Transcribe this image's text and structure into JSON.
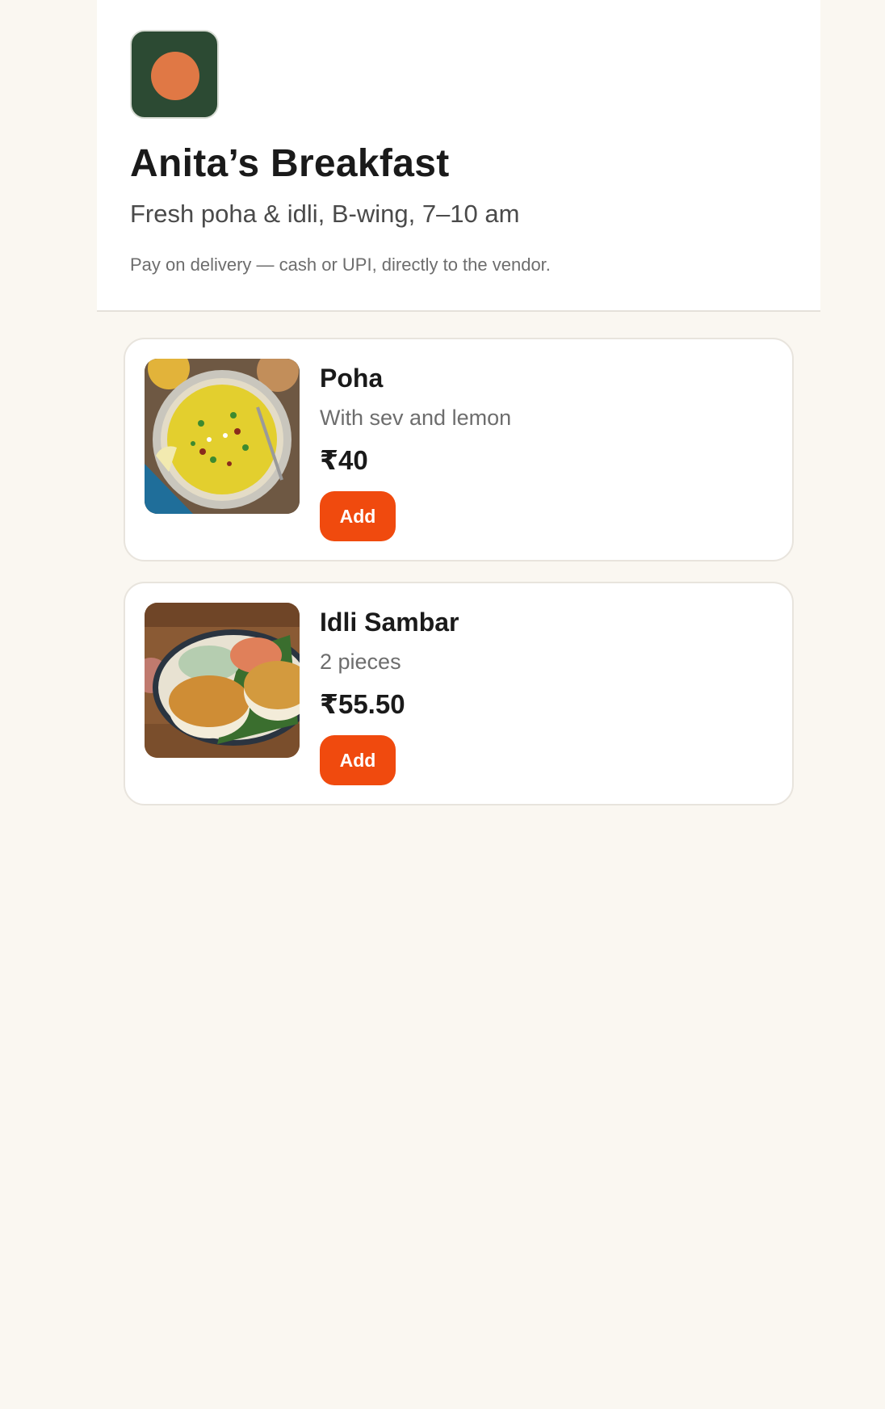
{
  "shop": {
    "logo_icon": "orange-dot-logo-icon",
    "title": "Anita’s Breakfast",
    "subtitle": "Fresh poha & idli, B-wing, 7–10 am",
    "payment_note": "Pay on delivery — cash or UPI, directly to the vendor."
  },
  "menu": {
    "items": [
      {
        "name": "Poha",
        "description": "With sev and lemon",
        "price": "₹40",
        "add_label": "Add",
        "photo": "poha-photo"
      },
      {
        "name": "Idli Sambar",
        "description": "2 pieces",
        "price": "₹55.50",
        "add_label": "Add",
        "photo": "idli-sambar-photo"
      }
    ]
  },
  "colors": {
    "background": "#faf7f1",
    "logo_background": "#2c4a33",
    "logo_dot": "#e07845",
    "add_button": "#f04a0e"
  }
}
